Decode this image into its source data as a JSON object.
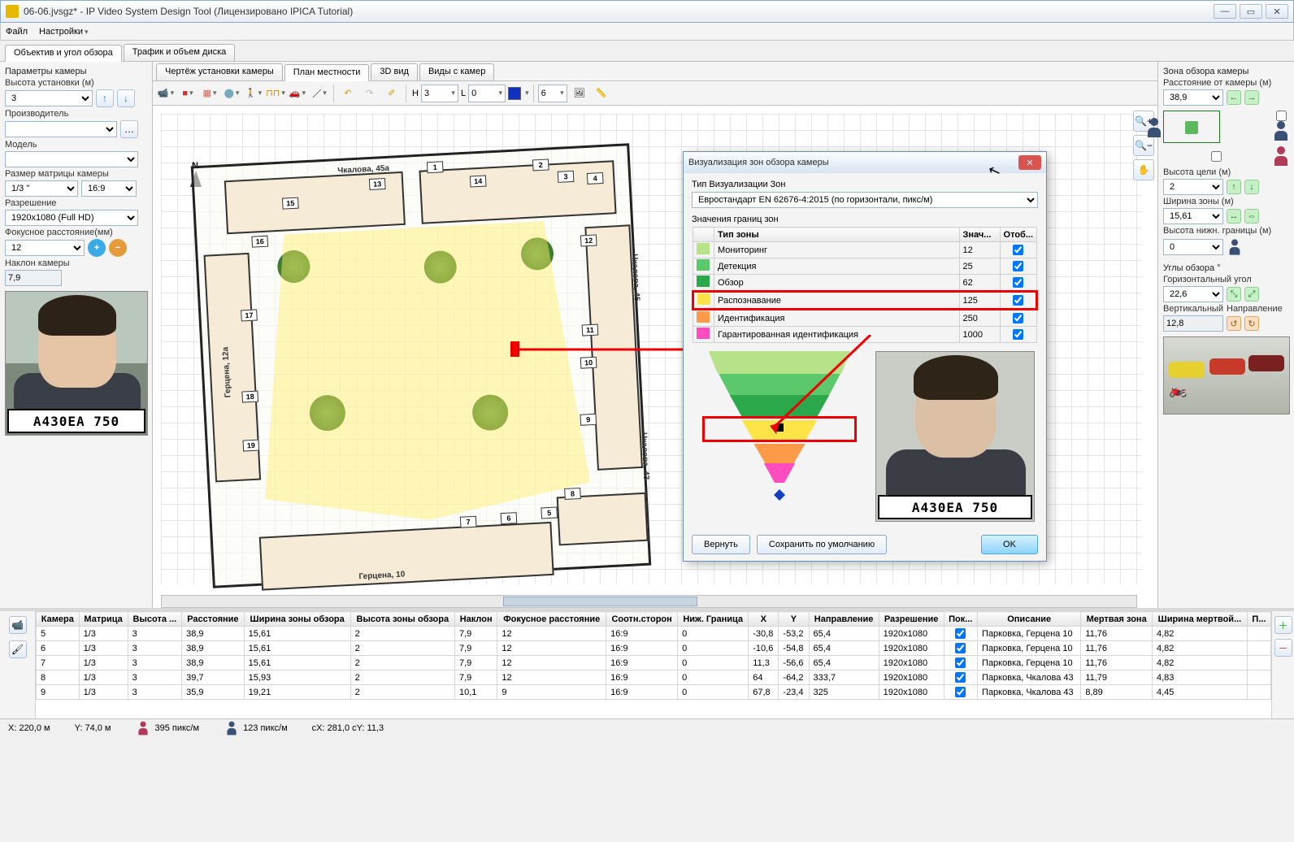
{
  "window": {
    "title": "06-06.jvsgz* - IP Video System Design Tool (Лицензировано  IPICA Tutorial)"
  },
  "menu": {
    "file": "Файл",
    "settings": "Настройки"
  },
  "topTabs": {
    "lens": "Объектив и угол обзора",
    "traffic": "Трафик и объем диска"
  },
  "leftPanel": {
    "paramsTitle": "Параметры камеры",
    "installHeight": "Высота установки (м)",
    "installHeightVal": "3",
    "manufacturer": "Производитель",
    "model": "Модель",
    "sensorSize": "Размер матрицы камеры",
    "sensorVal": "1/3 \"",
    "aspect": "16:9",
    "resolution": "Разрешение",
    "resolutionVal": "1920x1080 (Full HD)",
    "focal": "Фокусное расстояние(мм)",
    "focalVal": "12",
    "tilt": "Наклон камеры",
    "tiltVal": "7,9",
    "plate": "A430EA 750"
  },
  "centerTabs": {
    "drawing": "Чертёж установки камеры",
    "sitemap": "План местности",
    "view3d": "3D вид",
    "camviews": "Виды с камер"
  },
  "toolbar": {
    "h": "H",
    "hVal": "3",
    "l": "L",
    "lVal": "0",
    "rulerVal": "6"
  },
  "mapLabels": {
    "chkalova45a": "Чкалова, 45а",
    "chkalova45": "Чкалова, 45",
    "gertsena12a": "Герцена, 12а",
    "gertsena10": "Герцена, 10",
    "chkalova43": "Чкалова, 43"
  },
  "camNums": [
    "1",
    "2",
    "3",
    "4",
    "5",
    "6",
    "7",
    "8",
    "9",
    "10",
    "11",
    "12",
    "13",
    "14",
    "15",
    "16",
    "17",
    "18",
    "19"
  ],
  "rightPanel": {
    "zoneTitle": "Зона обзора камеры",
    "distLabel": "Расстояние от камеры (м)",
    "distVal": "38,9",
    "targetHLabel": "Высота цели (м)",
    "targetHVal": "2",
    "widthLabel": "Ширина зоны (м)",
    "widthVal": "15,61",
    "lowerHLabel": "Высота нижн. границы (м)",
    "lowerHVal": "0",
    "anglesTitle": "Углы обзора °",
    "horizLabel": "Горизонтальный угол",
    "horizVal": "22,6",
    "vertLabel": "Вертикальный",
    "vertVal": "12,8",
    "dirLabel": "Направление"
  },
  "dialog": {
    "title": "Визуализация зон обзора камеры",
    "typeLabel": "Тип Визуализации Зон",
    "typeVal": "Евростандарт EN 62676-4:2015 (по горизонтали, пикс/м)",
    "boundsLabel": "Значения границ зон",
    "cols": {
      "type": "Тип зоны",
      "val": "Знач...",
      "show": "Отоб..."
    },
    "zones": [
      {
        "color": "#b7e28a",
        "name": "Мониторинг",
        "val": "12"
      },
      {
        "color": "#5bc96b",
        "name": "Детекция",
        "val": "25"
      },
      {
        "color": "#2aa84a",
        "name": "Обзор",
        "val": "62"
      },
      {
        "color": "#ffe448",
        "name": "Распознавание",
        "val": "125"
      },
      {
        "color": "#ff9a4a",
        "name": "Идентификация",
        "val": "250"
      },
      {
        "color": "#ff4dc0",
        "name": "Гарантированная идентификация",
        "val": "1000"
      }
    ],
    "plate": "A430EA 750",
    "revert": "Вернуть",
    "saveDefault": "Сохранить по умолчанию",
    "ok": "OK"
  },
  "tableHeaders": [
    "Камера",
    "Матрица",
    "Высота ...",
    "Расстояние",
    "Ширина зоны обзора",
    "Высота зоны обзора",
    "Наклон",
    "Фокусное расстояние",
    "Соотн.сторон",
    "Ниж. Граница",
    "X",
    "Y",
    "Направление",
    "Разрешение",
    "Пок...",
    "Описание",
    "Мертвая зона",
    "Ширина мертвой...",
    "П..."
  ],
  "tableRows": [
    [
      "5",
      "1/3",
      "3",
      "38,9",
      "15,61",
      "2",
      "7,9",
      "12",
      "16:9",
      "0",
      "-30,8",
      "-53,2",
      "65,4",
      "1920x1080",
      true,
      "Парковка, Герцена 10",
      "11,76",
      "4,82",
      ""
    ],
    [
      "6",
      "1/3",
      "3",
      "38,9",
      "15,61",
      "2",
      "7,9",
      "12",
      "16:9",
      "0",
      "-10,6",
      "-54,8",
      "65,4",
      "1920x1080",
      true,
      "Парковка, Герцена 10",
      "11,76",
      "4,82",
      ""
    ],
    [
      "7",
      "1/3",
      "3",
      "38,9",
      "15,61",
      "2",
      "7,9",
      "12",
      "16:9",
      "0",
      "11,3",
      "-56,6",
      "65,4",
      "1920x1080",
      true,
      "Парковка, Герцена 10",
      "11,76",
      "4,82",
      ""
    ],
    [
      "8",
      "1/3",
      "3",
      "39,7",
      "15,93",
      "2",
      "7,9",
      "12",
      "16:9",
      "0",
      "64",
      "-64,2",
      "333,7",
      "1920x1080",
      true,
      "Парковка, Чкалова 43",
      "11,79",
      "4,83",
      ""
    ],
    [
      "9",
      "1/3",
      "3",
      "35,9",
      "19,21",
      "2",
      "10,1",
      "9",
      "16:9",
      "0",
      "67,8",
      "-23,4",
      "325",
      "1920x1080",
      true,
      "Парковка, Чкалова 43",
      "8,89",
      "4,45",
      ""
    ]
  ],
  "status": {
    "x": "X: 220,0 м",
    "y": "Y: 74,0 м",
    "pxm1": "395 пикс/м",
    "pxm2": "123 пикс/м",
    "cxy": "cX: 281,0 cY: 11,3"
  }
}
